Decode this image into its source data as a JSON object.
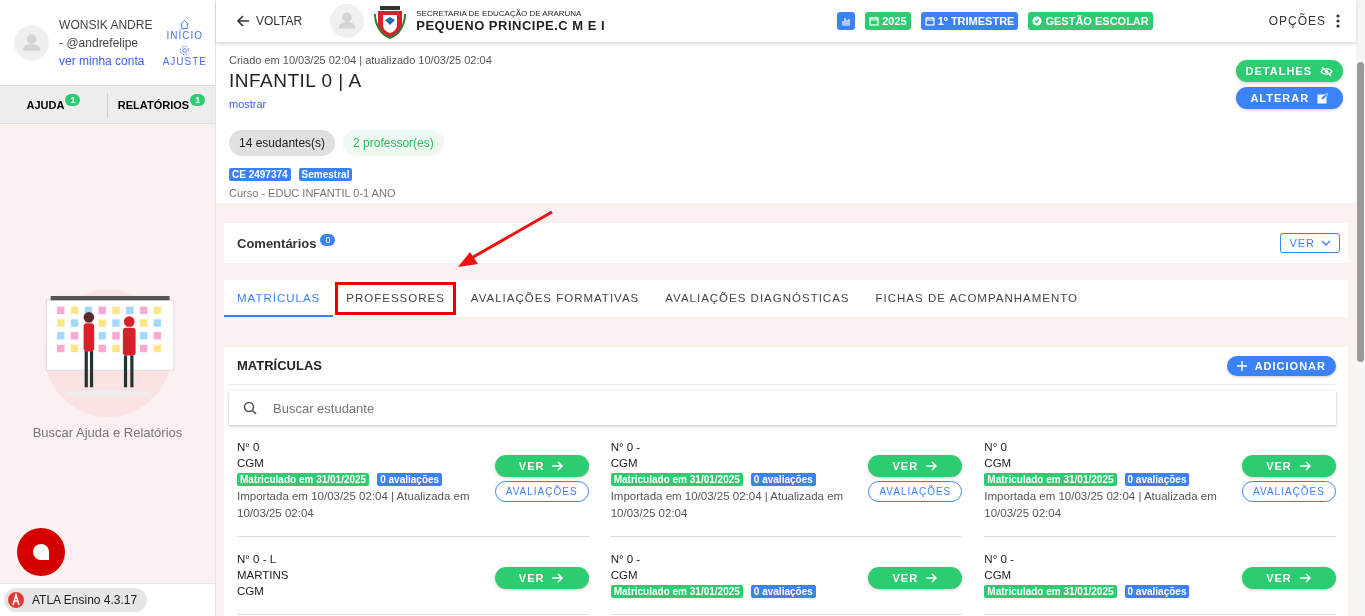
{
  "sidebar": {
    "user": {
      "name": "WONSIK ANDRE - @andrefelipe",
      "account_link": "ver minha conta"
    },
    "nav": [
      {
        "kind": "home",
        "label": "INÍCIO"
      },
      {
        "kind": "settings",
        "label": "AJUSTE"
      }
    ],
    "tabs": [
      {
        "label": "AJUDA",
        "count": "1"
      },
      {
        "label": "RELATÓRIOS",
        "count": "1"
      }
    ],
    "help_text": "Buscar Ajuda e Relatórios",
    "version": "ATLA Ensino 4.3.17"
  },
  "header": {
    "back": "VOLTAR",
    "org_subtitle": "SECRETARIA DE EDUCAÇÃO DE ARARUNA",
    "org_name": "PEQUENO PRINCIPE.C M E I",
    "chips": [
      {
        "kind": "chart",
        "color": "#3b82f6"
      },
      {
        "kind": "calendar",
        "label": "2025",
        "color": "#2ecc71"
      },
      {
        "kind": "calendar",
        "label": "1º TRIMESTRE",
        "color": "#3b82f6"
      },
      {
        "kind": "check",
        "label": "GESTÃO ESCOLAR",
        "color": "#2ecc71"
      }
    ],
    "options": "OPÇÕES"
  },
  "class_info": {
    "meta": "Criado em 10/03/25 02:04 | atualizado 10/03/25 02:04",
    "title": "INFANTIL 0 | A",
    "show_link": "mostrar",
    "buttons": [
      {
        "kind": "details",
        "label": "DETALHES"
      },
      {
        "kind": "edit",
        "label": "ALTERAR"
      }
    ],
    "counts": [
      {
        "kind": "students",
        "label": "14 esudantes(s)"
      },
      {
        "kind": "teachers",
        "label": "2 professor(es)"
      }
    ],
    "tags": [
      "CE 2497374",
      "Semestral"
    ],
    "course": "Curso - EDUC INFANTIL 0-1 ANO"
  },
  "comments": {
    "title": "Comentários",
    "count": "0",
    "button": "VER"
  },
  "tabs": [
    {
      "label": "MATRÍCULAS",
      "selected": true,
      "highlighted": false
    },
    {
      "label": "PROFESSORES",
      "selected": false,
      "highlighted": true
    },
    {
      "label": "AVALIAÇÕES FORMATIVAS",
      "selected": false,
      "highlighted": false
    },
    {
      "label": "AVALIAÇÕES DIAGNÓSTICAS",
      "selected": false,
      "highlighted": false
    },
    {
      "label": "FICHAS DE ACOMPANHAMENTO",
      "selected": false,
      "highlighted": false
    }
  ],
  "enrollments": {
    "title": "MATRÍCULAS",
    "add_button": "ADICIONAR",
    "search": {
      "placeholder": "Buscar estudante"
    },
    "items": [
      {
        "lines": [
          "N° 0",
          "CGM"
        ],
        "enrolled": "Matriculado em 31/01/2025",
        "evaluations": "0 avaliações",
        "updated": "Importada em 10/03/25 02:04 | Atualizada em 10/03/25 02:04",
        "view": "VER",
        "evaluations_button": "AVALIAÇÕES"
      },
      {
        "lines": [
          "N° 0 -",
          "CGM"
        ],
        "enrolled": "Matriculado em 31/01/2025",
        "evaluations": "0 avaliações",
        "updated": "Importada em 10/03/25 02:04 | Atualizada em 10/03/25 02:04",
        "view": "VER",
        "evaluations_button": "AVALIAÇÕES"
      },
      {
        "lines": [
          "N° 0",
          "CGM"
        ],
        "enrolled": "Matriculado em 31/01/2025",
        "evaluations": "0 avaliações",
        "updated": "Importada em 10/03/25 02:04 | Atualizada em 10/03/25 02:04",
        "view": "VER",
        "evaluations_button": "AVALIAÇÕES"
      },
      {
        "lines": [
          "N° 0 - L",
          "MARTINS",
          "CGM"
        ],
        "view": "VER"
      },
      {
        "lines": [
          "N° 0 -",
          "CGM"
        ],
        "enrolled": "Matriculado em 31/01/2025",
        "evaluations": "0 avaliações",
        "view": "VER"
      },
      {
        "lines": [
          "N° 0 -",
          "CGM"
        ],
        "enrolled": "Matriculado em 31/01/2025",
        "evaluations": "0 avaliações",
        "view": "VER"
      }
    ]
  }
}
